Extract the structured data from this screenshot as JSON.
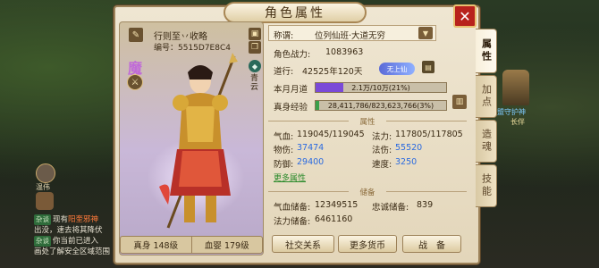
{
  "window": {
    "title": "角色属性"
  },
  "tabs": [
    {
      "label": "属性",
      "active": true
    },
    {
      "label": "加点",
      "active": false
    },
    {
      "label": "造魂",
      "active": false
    },
    {
      "label": "技能",
      "active": false
    }
  ],
  "character": {
    "name": "行则至丷收略",
    "id": "编号：5515D7E8C4",
    "mark_icon": "魔",
    "sect_label": "青云",
    "levels": [
      {
        "label": "真身 148级"
      },
      {
        "label": "血婴 179级"
      }
    ]
  },
  "info": {
    "title_label": "称谓:",
    "title_value": "位列仙班·大道无穷",
    "power_label": "角色战力:",
    "power_value": "1083963",
    "dao_label": "道行:",
    "dao_value": "42525年120天",
    "dao_badge": "无上仙",
    "moon_label": "本月月道",
    "moon_text": "2.1万/10万(21%)",
    "moon_progress": 0.21,
    "exp_label": "真身经验",
    "exp_text": "28,411,786/823,623,766(3%)",
    "exp_progress": 0.03
  },
  "attrs": {
    "header": "属性",
    "hp_label": "气血:",
    "hp_value": "119045/119045",
    "mp_label": "法力:",
    "mp_value": "117805/117805",
    "patk_label": "物伤:",
    "patk_value": "37474",
    "matk_label": "法伤:",
    "matk_value": "55520",
    "def_label": "防御:",
    "def_value": "29400",
    "spd_label": "速度:",
    "spd_value": "3250",
    "more": "更多属性"
  },
  "reserve": {
    "header": "储备",
    "hp_label": "气血储备:",
    "hp_value": "12349515",
    "loyal_label": "忠诚储备:",
    "loyal_value": "839",
    "mp_label": "法力储备:",
    "mp_value": "6461160"
  },
  "buttons": {
    "social": "社交关系",
    "currency": "更多货币",
    "equip": "战　备"
  },
  "chat": {
    "speaker": "温伟",
    "lines": [
      {
        "tag": "杂谈",
        "text": "现有",
        "hl": "阳奎邪神"
      },
      {
        "text": "出没，速去将其降伏"
      },
      {
        "tag": "杂谈",
        "text": "你当前已进入"
      },
      {
        "text": "画处了解安全区域范围"
      }
    ]
  },
  "npc": {
    "title": "仙盟守护神",
    "name": "长伴"
  },
  "colors": {
    "accent": "#b8221c",
    "moon_bar": "#7a4ad8",
    "exp_bar": "#3aa04a",
    "panel": "#efe6d2"
  }
}
